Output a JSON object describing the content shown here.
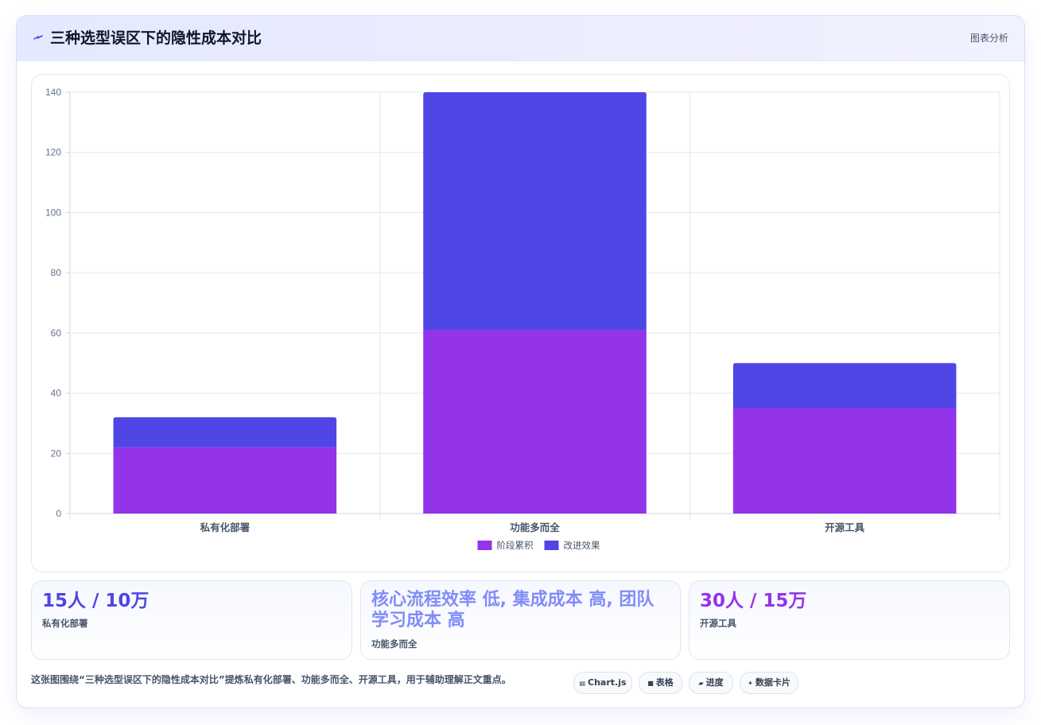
{
  "header": {
    "title": "三种选型误区下的隐性成本对比",
    "tag": "图表分析"
  },
  "chart_data": {
    "type": "bar",
    "stacked": true,
    "categories": [
      "私有化部署",
      "功能多而全",
      "开源工具"
    ],
    "series": [
      {
        "name": "阶段累积",
        "values": [
          22,
          61,
          35
        ],
        "color": "#9333ea"
      },
      {
        "name": "改进效果",
        "values": [
          10,
          79,
          15
        ],
        "color": "#4f46e5"
      }
    ],
    "ylim": [
      0,
      140
    ],
    "yticks": [
      0,
      20,
      40,
      60,
      80,
      100,
      120,
      140
    ],
    "grid": true,
    "legend": "bottom"
  },
  "stats": [
    {
      "value": "15人 / 10万",
      "label": "私有化部署",
      "color": "#4f46e5"
    },
    {
      "value": "核心流程效率 低, 集成成本 高, 团队学习成本 高",
      "label": "功能多而全",
      "color": "#818cf8"
    },
    {
      "value": "30人 / 15万",
      "label": "开源工具",
      "color": "#9333ea"
    }
  ],
  "caption": "这张图围绕“三种选型误区下的隐性成本对比”提炼私有化部署、功能多而全、开源工具，用于辅助理解正文重点。",
  "chips": [
    {
      "icon": "▤",
      "label": "Chart.js"
    },
    {
      "icon": "■",
      "label": "表格"
    },
    {
      "icon": "▰",
      "label": "进度"
    },
    {
      "icon": "✦",
      "label": "数据卡片"
    }
  ]
}
